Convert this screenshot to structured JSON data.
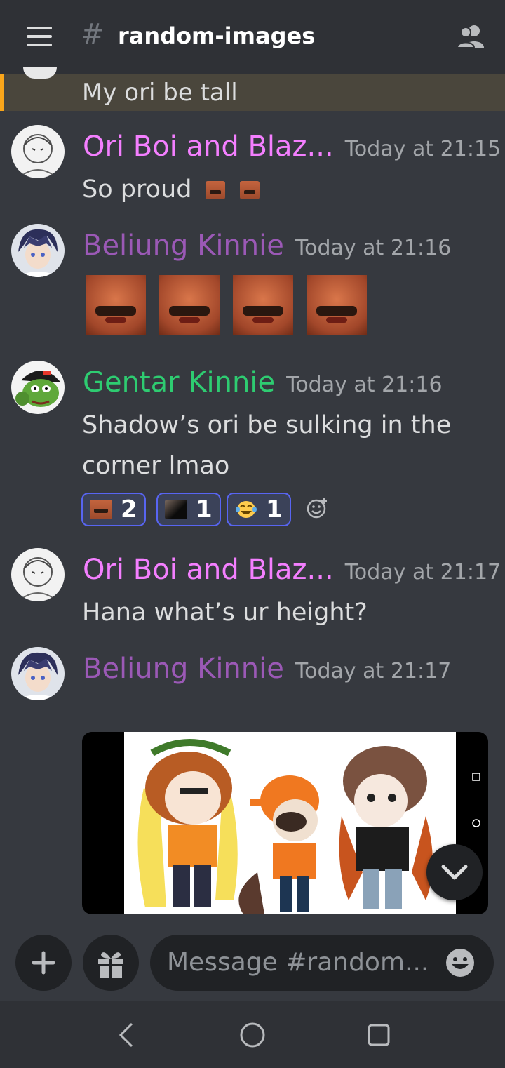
{
  "header": {
    "channel_name": "random-images",
    "hash_symbol": "#",
    "menu_icon": "hamburger-menu-icon",
    "members_icon": "members-icon"
  },
  "highlighted_message": {
    "text": "My ori be tall",
    "accent_color": "#faa61a"
  },
  "messages": [
    {
      "author": "Ori Boi and Blaz...",
      "author_color": "#f47fff",
      "timestamp": "Today at 21:15",
      "text": "So proud",
      "inline_emojis": [
        "laughing-man-emoji",
        "laughing-man-emoji"
      ]
    },
    {
      "author": "Beliung Kinnie",
      "author_color": "#9b59b6",
      "timestamp": "Today at 21:16",
      "jumbo_emojis": [
        "laughing-man-emoji",
        "laughing-man-emoji",
        "laughing-man-emoji",
        "laughing-man-emoji"
      ]
    },
    {
      "author": "Gentar Kinnie",
      "author_color": "#2ecc71",
      "timestamp": "Today at 21:16",
      "text_line1": "Shadow’s ori be sulking in the",
      "text_line2": "corner lmao",
      "reactions": [
        {
          "emoji": "laughing-man-emoji",
          "count": "2"
        },
        {
          "emoji": "dark-figure-emoji",
          "count": "1"
        },
        {
          "emoji": "crying-laughing-emoji",
          "count": "1"
        }
      ],
      "add_reaction_icon": "add-reaction-icon"
    },
    {
      "author": "Ori Boi and Blaz...",
      "author_color": "#f47fff",
      "timestamp": "Today at 21:17",
      "text": "Hana what’s ur height?"
    },
    {
      "author": "Beliung Kinnie",
      "author_color": "#9b59b6",
      "timestamp": "Today at 21:17",
      "attachment": "image-attachment"
    }
  ],
  "composer": {
    "placeholder": "Message #random...",
    "add_icon": "plus-icon",
    "gift_icon": "gift-icon",
    "emoji_icon": "emoji-icon"
  },
  "scroll_button_icon": "chevron-down-icon",
  "navbar": {
    "back_icon": "back-icon",
    "home_icon": "home-icon",
    "recents_icon": "recents-icon"
  }
}
